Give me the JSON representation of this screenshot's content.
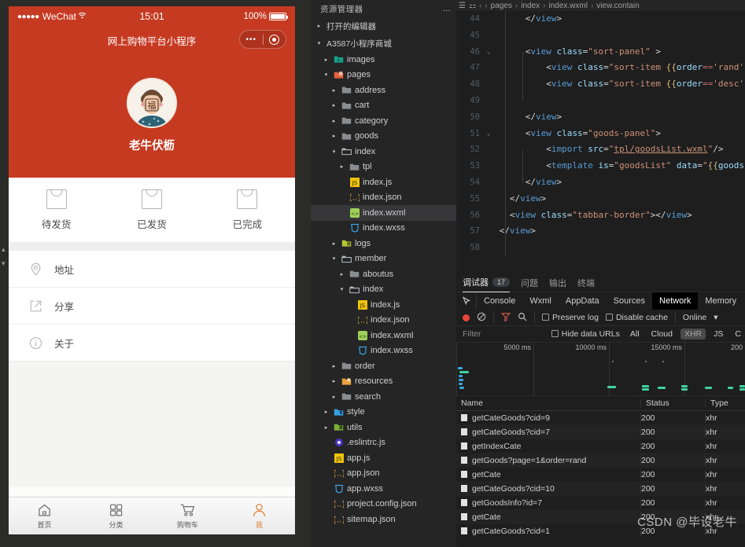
{
  "simulator": {
    "status_bar": {
      "dots": "●●●●●",
      "carrier": "WeChat",
      "wifi": "ᴘ",
      "time": "15:01",
      "battery": "100%"
    },
    "nav": {
      "title": "网上购物平台小程序",
      "capsule_dots": "•••"
    },
    "profile": {
      "username": "老牛伏枥"
    },
    "order_tabs": [
      {
        "label": "待发货",
        "icon": "bag-icon"
      },
      {
        "label": "已发货",
        "icon": "bag-icon"
      },
      {
        "label": "已完成",
        "icon": "bag-icon"
      }
    ],
    "menu": [
      {
        "label": "地址",
        "icon": "location-pin-icon"
      },
      {
        "label": "分享",
        "icon": "share-external-icon"
      },
      {
        "label": "关于",
        "icon": "info-circle-icon"
      }
    ],
    "tabbar": [
      {
        "label": "首页",
        "icon": "home-icon",
        "active": false
      },
      {
        "label": "分类",
        "icon": "grid-icon",
        "active": false
      },
      {
        "label": "购物车",
        "icon": "cart-icon",
        "active": false
      },
      {
        "label": "我",
        "icon": "user-icon",
        "active": true
      }
    ],
    "accent_color": "#c63a22",
    "tab_active_color": "#e27a2a"
  },
  "explorer": {
    "title": "资源管理器",
    "more": "…",
    "sections": [
      {
        "label": "打开的编辑器",
        "state": "collapsed"
      },
      {
        "label": "A3587小程序商城",
        "state": "expanded"
      }
    ],
    "tree": [
      {
        "label": "images",
        "depth": 1,
        "type": "folder-media",
        "state": "collapsed",
        "selected": false
      },
      {
        "label": "pages",
        "depth": 1,
        "type": "folder-pages",
        "state": "expanded",
        "selected": false
      },
      {
        "label": "address",
        "depth": 2,
        "type": "folder",
        "state": "collapsed",
        "selected": false
      },
      {
        "label": "cart",
        "depth": 2,
        "type": "folder",
        "state": "collapsed",
        "selected": false
      },
      {
        "label": "category",
        "depth": 2,
        "type": "folder",
        "state": "collapsed",
        "selected": false
      },
      {
        "label": "goods",
        "depth": 2,
        "type": "folder",
        "state": "collapsed",
        "selected": false
      },
      {
        "label": "index",
        "depth": 2,
        "type": "folder-open",
        "state": "expanded",
        "selected": false
      },
      {
        "label": "tpl",
        "depth": 3,
        "type": "folder",
        "state": "collapsed",
        "selected": false
      },
      {
        "label": "index.js",
        "depth": 3,
        "type": "js",
        "state": "file",
        "selected": false
      },
      {
        "label": "index.json",
        "depth": 3,
        "type": "json",
        "state": "file",
        "selected": false
      },
      {
        "label": "index.wxml",
        "depth": 3,
        "type": "wxml",
        "state": "file",
        "selected": true
      },
      {
        "label": "index.wxss",
        "depth": 3,
        "type": "wxss",
        "state": "file",
        "selected": false
      },
      {
        "label": "logs",
        "depth": 2,
        "type": "folder-logs",
        "state": "collapsed",
        "selected": false
      },
      {
        "label": "member",
        "depth": 2,
        "type": "folder-open",
        "state": "expanded",
        "selected": false
      },
      {
        "label": "aboutus",
        "depth": 3,
        "type": "folder",
        "state": "collapsed",
        "selected": false
      },
      {
        "label": "index",
        "depth": 3,
        "type": "folder-open",
        "state": "expanded",
        "selected": false
      },
      {
        "label": "index.js",
        "depth": 4,
        "type": "js",
        "state": "file",
        "selected": false
      },
      {
        "label": "index.json",
        "depth": 4,
        "type": "json",
        "state": "file",
        "selected": false
      },
      {
        "label": "index.wxml",
        "depth": 4,
        "type": "wxml",
        "state": "file",
        "selected": false
      },
      {
        "label": "index.wxss",
        "depth": 4,
        "type": "wxss",
        "state": "file",
        "selected": false
      },
      {
        "label": "order",
        "depth": 2,
        "type": "folder",
        "state": "collapsed",
        "selected": false
      },
      {
        "label": "resources",
        "depth": 2,
        "type": "folder-res",
        "state": "collapsed",
        "selected": false
      },
      {
        "label": "search",
        "depth": 2,
        "type": "folder",
        "state": "collapsed",
        "selected": false
      },
      {
        "label": "style",
        "depth": 1,
        "type": "folder-style",
        "state": "collapsed",
        "selected": false
      },
      {
        "label": "utils",
        "depth": 1,
        "type": "folder-utils",
        "state": "collapsed",
        "selected": false
      },
      {
        "label": ".eslintrc.js",
        "depth": 1,
        "type": "eslint",
        "state": "file",
        "selected": false
      },
      {
        "label": "app.js",
        "depth": 1,
        "type": "js",
        "state": "file",
        "selected": false
      },
      {
        "label": "app.json",
        "depth": 1,
        "type": "json",
        "state": "file",
        "selected": false
      },
      {
        "label": "app.wxss",
        "depth": 1,
        "type": "wxss",
        "state": "file",
        "selected": false
      },
      {
        "label": "project.config.json",
        "depth": 1,
        "type": "json",
        "state": "file",
        "selected": false
      },
      {
        "label": "sitemap.json",
        "depth": 1,
        "type": "json",
        "state": "file",
        "selected": false
      }
    ]
  },
  "editor": {
    "breadcrumb": [
      "pages",
      "index",
      "index.wxml",
      "view.contain"
    ],
    "lines": [
      {
        "no": "44",
        "fold": "",
        "html": "      <span class='t-pun'>&lt;/</span><span class='t-tag'>view</span><span class='t-pun'>&gt;</span>"
      },
      {
        "no": "45",
        "fold": "",
        "html": ""
      },
      {
        "no": "46",
        "fold": "v",
        "html": "      <span class='t-pun'>&lt;</span><span class='t-tag'>view</span> <span class='t-nm'>class</span><span class='t-pun'>=</span><span class='t-str'>\"sort-panel\"</span> <span class='t-pun'>&gt;</span>"
      },
      {
        "no": "47",
        "fold": "",
        "html": "          <span class='t-pun'>&lt;</span><span class='t-tag'>view</span> <span class='t-nm'>class</span><span class='t-pun'>=</span><span class='t-str'>\"sort-item </span><span class='t-br'>{{</span><span class='t-nm'>order</span><span class='t-op'>==</span><span class='t-str'>'rand'</span><span class='t-op'>?</span><span class='t-str'>'on'</span><span class='t-op'>:</span><span class='t-str'>'</span>"
      },
      {
        "no": "48",
        "fold": "",
        "html": "          <span class='t-pun'>&lt;</span><span class='t-tag'>view</span> <span class='t-nm'>class</span><span class='t-pun'>=</span><span class='t-str'>\"sort-item </span><span class='t-br'>{{</span><span class='t-nm'>order</span><span class='t-op'>==</span><span class='t-str'>'desc'</span><span class='t-op'>?</span><span class='t-str'>'on'</span><span class='t-op'>:</span><span class='t-str'>'</span>"
      },
      {
        "no": "49",
        "fold": "",
        "html": ""
      },
      {
        "no": "50",
        "fold": "",
        "html": "      <span class='t-pun'>&lt;/</span><span class='t-tag'>view</span><span class='t-pun'>&gt;</span>"
      },
      {
        "no": "51",
        "fold": "v",
        "html": "      <span class='t-pun'>&lt;</span><span class='t-tag'>view</span> <span class='t-nm'>class</span><span class='t-pun'>=</span><span class='t-str'>\"goods-panel\"</span><span class='t-pun'>&gt;</span>"
      },
      {
        "no": "52",
        "fold": "",
        "html": "          <span class='t-pun'>&lt;</span><span class='t-tag'>import</span> <span class='t-nm'>src</span><span class='t-pun'>=</span><span class='t-str'>\"</span><span class='t-lnk'>tpl/goodsList.wxml</span><span class='t-str'>\"</span><span class='t-pun'>/&gt;</span>"
      },
      {
        "no": "53",
        "fold": "",
        "html": "          <span class='t-pun'>&lt;</span><span class='t-tag'>template</span> <span class='t-nm'>is</span><span class='t-pun'>=</span><span class='t-str'>\"goodsList\"</span> <span class='t-nm'>data</span><span class='t-pun'>=</span><span class='t-str'>\"</span><span class='t-br'>{{</span><span class='t-nm'>goodsList</span><span class='t-op'>:</span><span class='t-nm'>go</span>"
      },
      {
        "no": "54",
        "fold": "",
        "html": "      <span class='t-pun'>&lt;/</span><span class='t-tag'>view</span><span class='t-pun'>&gt;</span>"
      },
      {
        "no": "55",
        "fold": "",
        "html": "   <span class='t-pun'>&lt;/</span><span class='t-tag'>view</span><span class='t-pun'>&gt;</span>"
      },
      {
        "no": "56",
        "fold": "",
        "html": "   <span class='t-pun'>&lt;</span><span class='t-tag'>view</span> <span class='t-nm'>class</span><span class='t-pun'>=</span><span class='t-str'>\"tabbar-border\"</span><span class='t-pun'>&gt;&lt;/</span><span class='t-tag'>view</span><span class='t-pun'>&gt;</span>"
      },
      {
        "no": "57",
        "fold": "",
        "html": " <span class='t-pun'>&lt;/</span><span class='t-tag'>view</span><span class='t-pun'>&gt;</span>"
      },
      {
        "no": "58",
        "fold": "",
        "html": ""
      }
    ]
  },
  "devtools": {
    "panel_tabs": [
      {
        "label": "调试器",
        "badge": "17",
        "active": true
      },
      {
        "label": "问题",
        "badge": "",
        "active": false
      },
      {
        "label": "输出",
        "badge": "",
        "active": false
      },
      {
        "label": "终端",
        "badge": "",
        "active": false
      }
    ],
    "sub_tabs": [
      {
        "label": "Console",
        "active": false
      },
      {
        "label": "Wxml",
        "active": false
      },
      {
        "label": "AppData",
        "active": false
      },
      {
        "label": "Sources",
        "active": false
      },
      {
        "label": "Network",
        "active": true
      },
      {
        "label": "Memory",
        "active": false
      }
    ],
    "controls": {
      "preserve_log": "Preserve log",
      "disable_cache": "Disable cache",
      "throttle": "Online",
      "throttle_caret": "▾"
    },
    "filter": {
      "placeholder": "Filter",
      "hide_data_urls": "Hide data URLs",
      "types": [
        {
          "label": "All",
          "active": false
        },
        {
          "label": "Cloud",
          "active": false
        },
        {
          "label": "XHR",
          "active": true
        },
        {
          "label": "JS",
          "active": false
        },
        {
          "label": "C",
          "active": false
        }
      ]
    },
    "timeline_ticks": [
      "5000 ms",
      "10000 ms",
      "15000 ms",
      "200"
    ],
    "table": {
      "columns": [
        "Name",
        "Status",
        "Type"
      ],
      "rows": [
        {
          "name": "getCateGoods?cid=9",
          "status": "200",
          "type": "xhr"
        },
        {
          "name": "getCateGoods?cid=7",
          "status": "200",
          "type": "xhr"
        },
        {
          "name": "getIndexCate",
          "status": "200",
          "type": "xhr"
        },
        {
          "name": "getGoods?page=1&order=rand",
          "status": "200",
          "type": "xhr"
        },
        {
          "name": "getCate",
          "status": "200",
          "type": "xhr"
        },
        {
          "name": "getCateGoods?cid=10",
          "status": "200",
          "type": "xhr"
        },
        {
          "name": "getGoodsInfo?id=7",
          "status": "200",
          "type": "xhr"
        },
        {
          "name": "getCate",
          "status": "200",
          "type": "xhr"
        },
        {
          "name": "getCateGoods?cid=1",
          "status": "200",
          "type": "xhr"
        }
      ]
    }
  },
  "watermark": "CSDN @毕设老牛"
}
